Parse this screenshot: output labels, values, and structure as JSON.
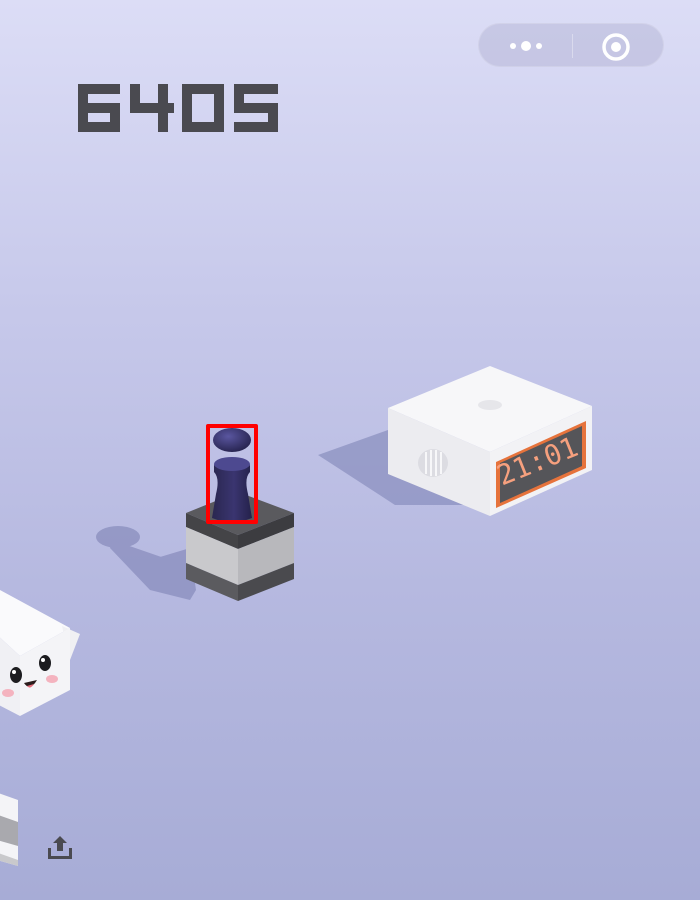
{
  "game": {
    "score": "6405",
    "clock_display": "21:01"
  },
  "capsule": {
    "more_icon": "more-dots-icon",
    "close_icon": "target-circle-icon"
  },
  "share": {
    "icon": "share-upload-icon"
  },
  "highlight": {
    "target": "player-piece",
    "color": "#ff0000"
  },
  "colors": {
    "background_top": "#dcddf6",
    "background_bottom": "#a7acd6",
    "score": "#4a4a50",
    "player": "#2f2c5e",
    "clock_digits": "#f08a6a",
    "clock_ring": "#e6733c"
  }
}
